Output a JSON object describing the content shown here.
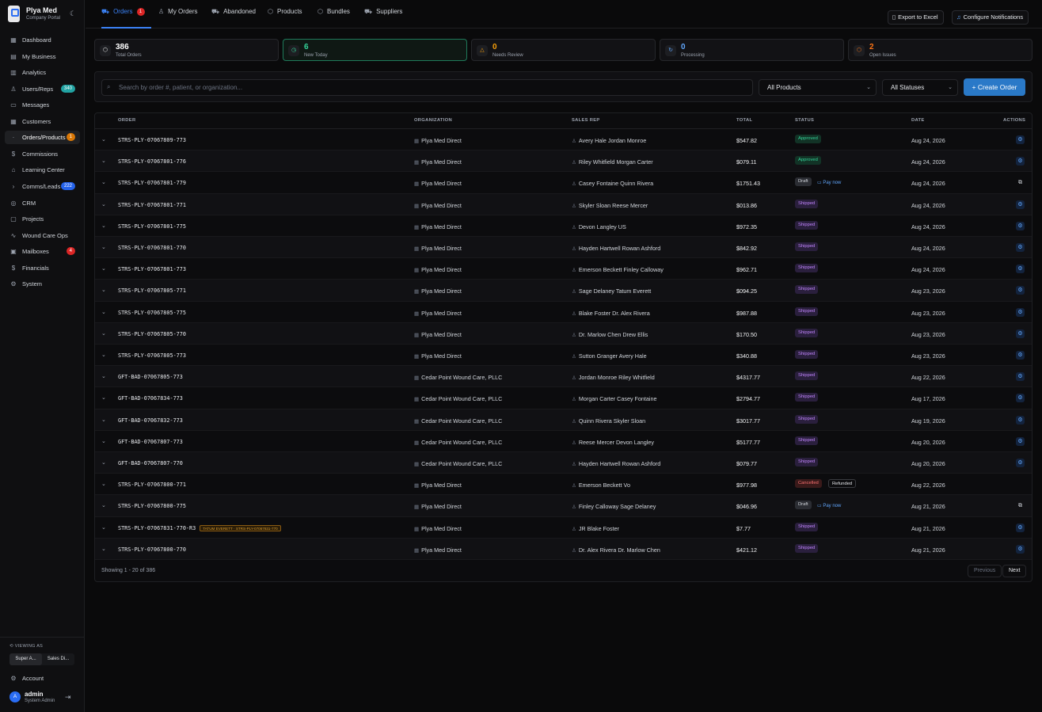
{
  "brand": {
    "name": "Plya Med",
    "sub": "Company Portal"
  },
  "sidebar": {
    "items": [
      {
        "label": "Dashboard",
        "icon": "dashboard-icon",
        "glyph": "▦"
      },
      {
        "label": "My Business",
        "icon": "business-icon",
        "glyph": "▤"
      },
      {
        "label": "Analytics",
        "icon": "analytics-icon",
        "glyph": "▥"
      },
      {
        "label": "Users/Reps",
        "icon": "users-icon",
        "glyph": "♙",
        "badge": "340",
        "badge_color": "teal"
      },
      {
        "label": "Messages",
        "icon": "messages-icon",
        "glyph": "▭"
      },
      {
        "label": "Customers",
        "icon": "customers-icon",
        "glyph": "▦"
      },
      {
        "label": "Orders/Products",
        "icon": "orders-icon",
        "glyph": "·",
        "badge": "1",
        "badge_color": "orange",
        "active": true
      },
      {
        "label": "Commissions",
        "icon": "dollar-icon",
        "glyph": "$"
      },
      {
        "label": "Learning Center",
        "icon": "graduation-icon",
        "glyph": "⌂"
      },
      {
        "label": "Comms/Leads",
        "icon": "chevron-right-icon",
        "glyph": "›",
        "badge": "222",
        "badge_color": "blue"
      },
      {
        "label": "CRM",
        "icon": "crm-icon",
        "glyph": "◎"
      },
      {
        "label": "Projects",
        "icon": "projects-icon",
        "glyph": "▢"
      },
      {
        "label": "Wound Care Ops",
        "icon": "pulse-icon",
        "glyph": "∿"
      },
      {
        "label": "Mailboxes",
        "icon": "mailbox-icon",
        "glyph": "▣",
        "badge": "4",
        "badge_color": "red"
      },
      {
        "label": "Financials",
        "icon": "dollar-icon",
        "glyph": "$"
      },
      {
        "label": "System",
        "icon": "gear-icon",
        "glyph": "⚙"
      }
    ],
    "viewing_as": "VIEWING AS",
    "view_options": [
      "Super A...",
      "Sales Di..."
    ],
    "account": "Account",
    "user": {
      "initial": "A",
      "name": "admin",
      "role": "System Admin"
    }
  },
  "tabs": [
    {
      "label": "Orders",
      "icon": "cart-icon",
      "glyph": "⛟",
      "badge": "1",
      "active": true
    },
    {
      "label": "My Orders",
      "icon": "people-icon",
      "glyph": "♙"
    },
    {
      "label": "Abandoned",
      "icon": "cart-icon",
      "glyph": "⛟"
    },
    {
      "label": "Products",
      "icon": "box-icon",
      "glyph": "⬡"
    },
    {
      "label": "Bundles",
      "icon": "box-icon",
      "glyph": "⬡"
    },
    {
      "label": "Suppliers",
      "icon": "truck-icon",
      "glyph": "⛟"
    }
  ],
  "actions": {
    "export": "Export to Excel",
    "notify": "Configure Notifications"
  },
  "stats": [
    {
      "value": "386",
      "label": "Total Orders",
      "color": "#ffffff",
      "icon": "box-icon",
      "glyph": "⬡"
    },
    {
      "value": "6",
      "label": "New Today",
      "color": "#34d399",
      "icon": "clock-icon",
      "glyph": "◷"
    },
    {
      "value": "0",
      "label": "Needs Review",
      "color": "#f59e0b",
      "icon": "warning-icon",
      "glyph": "△"
    },
    {
      "value": "0",
      "label": "Processing",
      "color": "#60a5fa",
      "icon": "refresh-icon",
      "glyph": "↻"
    },
    {
      "value": "2",
      "label": "Open Issues",
      "color": "#f97316",
      "icon": "package-icon",
      "glyph": "⬡"
    }
  ],
  "filters": {
    "search_placeholder": "Search by order #, patient, or organization...",
    "products": "All Products",
    "statuses": "All Statuses",
    "create": "Create Order"
  },
  "table": {
    "headers": [
      "ORDER",
      "ORGANIZATION",
      "SALES REP",
      "TOTAL",
      "STATUS",
      "DATE",
      "ACTIONS"
    ],
    "rows": [
      {
        "order": "STRS-PLY-07067809-773",
        "org": "Plya Med Direct",
        "rep": "Avery Hale Jordan Monroe",
        "total": "$547.82",
        "status": "Approved",
        "date": "Aug 24, 2026",
        "action": "view"
      },
      {
        "order": "STRS-PLY-07067801-776",
        "org": "Plya Med Direct",
        "rep": "Riley Whitfield Morgan Carter",
        "total": "$079.11",
        "status": "Approved",
        "date": "Aug 24, 2026",
        "action": "view"
      },
      {
        "order": "STRS-PLY-07067801-779",
        "org": "Plya Med Direct",
        "rep": "Casey Fontaine Quinn Rivera",
        "total": "$1751.43",
        "status": "Draft",
        "extra": "Pay now",
        "date": "Aug 24, 2026",
        "action": "copy"
      },
      {
        "order": "STRS-PLY-07067801-771",
        "org": "Plya Med Direct",
        "rep": "Skyler Sloan Reese Mercer",
        "total": "$013.86",
        "status": "Shipped",
        "date": "Aug 24, 2026",
        "action": "view"
      },
      {
        "order": "STRS-PLY-07067801-775",
        "org": "Plya Med Direct",
        "rep": "Devon Langley US",
        "total": "$972.35",
        "status": "Shipped",
        "date": "Aug 24, 2026",
        "action": "view"
      },
      {
        "order": "STRS-PLY-07067801-770",
        "org": "Plya Med Direct",
        "rep": "Hayden Hartwell Rowan Ashford",
        "total": "$842.92",
        "status": "Shipped",
        "date": "Aug 24, 2026",
        "action": "view"
      },
      {
        "order": "STRS-PLY-07067801-773",
        "org": "Plya Med Direct",
        "rep": "Emerson Beckett Finley Calloway",
        "total": "$962.71",
        "status": "Shipped",
        "date": "Aug 24, 2026",
        "action": "view"
      },
      {
        "order": "STRS-PLY-07067805-771",
        "org": "Plya Med Direct",
        "rep": "Sage Delaney Tatum Everett",
        "total": "$094.25",
        "status": "Shipped",
        "date": "Aug 23, 2026",
        "action": "view"
      },
      {
        "order": "STRS-PLY-07067805-775",
        "org": "Plya Med Direct",
        "rep": "Blake Foster Dr. Alex Rivera",
        "total": "$987.88",
        "status": "Shipped",
        "date": "Aug 23, 2026",
        "action": "view"
      },
      {
        "order": "STRS-PLY-07067805-770",
        "org": "Plya Med Direct",
        "rep": "Dr. Marlow Chen Drew Ellis",
        "total": "$170.50",
        "status": "Shipped",
        "date": "Aug 23, 2026",
        "action": "view"
      },
      {
        "order": "STRS-PLY-07067805-773",
        "org": "Plya Med Direct",
        "rep": "Sutton Granger Avery Hale",
        "total": "$340.88",
        "status": "Shipped",
        "date": "Aug 23, 2026",
        "action": "view"
      },
      {
        "order": "GFT-BAD-07067805-773",
        "org": "Cedar Point Wound Care, PLLC",
        "rep": "Jordan Monroe Riley Whitfield",
        "total": "$4317.77",
        "status": "Shipped",
        "date": "Aug 22, 2026",
        "action": "view"
      },
      {
        "order": "GFT-BAD-07067834-773",
        "org": "Cedar Point Wound Care, PLLC",
        "rep": "Morgan Carter Casey Fontaine",
        "total": "$2794.77",
        "status": "Shipped",
        "date": "Aug 17, 2026",
        "action": "view"
      },
      {
        "order": "GFT-BAD-07067832-773",
        "org": "Cedar Point Wound Care, PLLC",
        "rep": "Quinn Rivera Skyler Sloan",
        "total": "$3017.77",
        "status": "Shipped",
        "date": "Aug 19, 2026",
        "action": "view"
      },
      {
        "order": "GFT-BAD-07067807-773",
        "org": "Cedar Point Wound Care, PLLC",
        "rep": "Reese Mercer Devon Langley",
        "total": "$5177.77",
        "status": "Shipped",
        "date": "Aug 20, 2026",
        "action": "view"
      },
      {
        "order": "GFT-BAD-07067807-770",
        "org": "Cedar Point Wound Care, PLLC",
        "rep": "Hayden Hartwell Rowan Ashford",
        "total": "$079.77",
        "status": "Shipped",
        "date": "Aug 20, 2026",
        "action": "view"
      },
      {
        "order": "STRS-PLY-07067800-771",
        "org": "Plya Med Direct",
        "rep": "Emerson Beckett Vo",
        "total": "$977.98",
        "status": "Cancelled",
        "refund": "Refunded",
        "date": "Aug 22, 2026",
        "action": ""
      },
      {
        "order": "STRS-PLY-07067800-775",
        "org": "Plya Med Direct",
        "rep": "Finley Calloway Sage Delaney",
        "total": "$046.96",
        "status": "Draft",
        "extra": "Pay now",
        "date": "Aug 21, 2026",
        "action": "copy"
      },
      {
        "order": "STRS-PLY-07067831-770-R3",
        "tag": "TATUM EVERETT · STRS-PLY-07067831-770",
        "org": "Plya Med Direct",
        "rep": "JR Blake Foster",
        "total": "$7.77",
        "status": "Shipped",
        "date": "Aug 21, 2026",
        "action": "view"
      },
      {
        "order": "STRS-PLY-07067800-770",
        "org": "Plya Med Direct",
        "rep": "Dr. Alex Rivera Dr. Marlow Chen",
        "total": "$421.12",
        "status": "Shipped",
        "date": "Aug 21, 2026",
        "action": "view"
      }
    ],
    "showing": "Showing 1 - 20 of 386",
    "prev": "Previous",
    "next": "Next"
  }
}
